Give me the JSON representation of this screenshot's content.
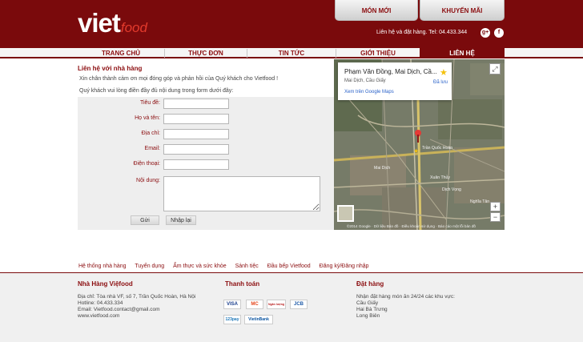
{
  "brand": {
    "logo_main": "viet",
    "logo_sub": "food"
  },
  "top_tabs": [
    {
      "label": "MÓN MỚI"
    },
    {
      "label": "KHUYẾN MÃI"
    }
  ],
  "header": {
    "contact": "Liên hệ và đặt hàng. Tel: 04.433.344"
  },
  "social": [
    {
      "icon": "google-plus-icon",
      "glyph": "g+"
    },
    {
      "icon": "facebook-icon",
      "glyph": "f"
    }
  ],
  "nav": [
    {
      "label": "TRANG CHỦ"
    },
    {
      "label": "THỰC ĐƠN"
    },
    {
      "label": "TIN TỨC"
    },
    {
      "label": "GIỚI THIỆU"
    },
    {
      "label": "LIÊN HỆ"
    }
  ],
  "contact": {
    "title": "Liên hệ với nhà hàng",
    "intro": "Xin chân thành cảm ơn mọi đóng góp và phản hồi của Quý khách cho Vietfood !",
    "instruction": "Quý khách vui lòng điền đầy đủ nội dung trong form dưới đây:",
    "fields": [
      {
        "label": "Tiêu đề:"
      },
      {
        "label": "Họ và tên:"
      },
      {
        "label": "Địa chỉ:"
      },
      {
        "label": "Email:"
      },
      {
        "label": "Điện thoại:"
      }
    ],
    "message_label": "Nội dung:",
    "submit": "Gửi",
    "reset": "Nhập lại"
  },
  "map": {
    "place": "Phạm Văn Đồng, Mai Dịch, Cầ...",
    "area": "Mai Dịch, Cầu Giấy",
    "link": "Xem trên Google Maps",
    "saved": "Đã lưu",
    "zoom_in": "+",
    "zoom_out": "−",
    "attribution": "©2014 Google · Dữ liệu Bản đồ · Điều khoản sử dụng · Báo cáo một lỗi bản đồ",
    "labels": [
      "Trần Quốc Hoàn",
      "Xuân Thủy",
      "Mai Dịch",
      "Dịch Vọng",
      "Nghĩa Tân"
    ]
  },
  "footer_links": [
    "Hệ thống nhà hàng",
    "Tuyển dụng",
    "Ẩm thực và sức khỏe",
    "Sảnh tiệc",
    "Đầu bếp Vietfood",
    "Đăng ký/Đăng nhập"
  ],
  "footer": {
    "col1_title": "Nhà Hàng Việfood",
    "col1_lines": [
      "Địa chỉ: Tòa nhà VF, số 7, Trần Quốc Hoàn, Hà Nội",
      "Hotline: 04.433.334",
      "Email: Vietfood.contact@gmail.com",
      "www.vietfood.com"
    ],
    "col2_title": "Thanh toán",
    "payments": [
      "VISA",
      "MC",
      "Ngân lượng",
      "JCB",
      "123pay",
      "VietinBank"
    ],
    "col3_title": "Đặt hàng",
    "col3_lines": [
      "Nhận đặt hàng món ăn 24/24 các khu vực:",
      "Cầu Giấy",
      "Hai Bà Trưng",
      "Long Biên"
    ]
  },
  "colors": {
    "brand_red": "#7a0a0c",
    "link_blue": "#2a62c9"
  }
}
